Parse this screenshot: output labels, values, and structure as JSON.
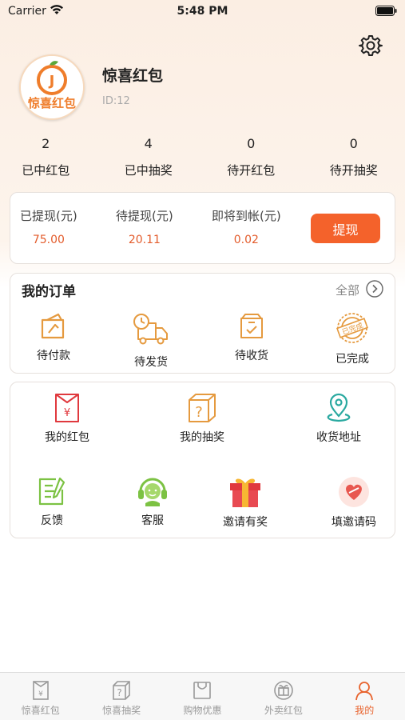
{
  "status_bar": {
    "carrier": "Carrier",
    "time": "5:48 PM"
  },
  "profile": {
    "avatar_logo_text": "J",
    "avatar_caption": "惊喜红包",
    "name": "惊喜红包",
    "id_text": "ID:12"
  },
  "stats": [
    {
      "count": "2",
      "label": "已中红包"
    },
    {
      "count": "4",
      "label": "已中抽奖"
    },
    {
      "count": "0",
      "label": "待开红包"
    },
    {
      "count": "0",
      "label": "待开抽奖"
    }
  ],
  "wallet": {
    "withdrawn_label": "已提现(元)",
    "withdrawn_value": "75.00",
    "pending_label": "待提现(元)",
    "pending_value": "20.11",
    "arriving_label": "即将到帐(元)",
    "arriving_value": "0.02",
    "withdraw_button": "提现"
  },
  "orders": {
    "title": "我的订单",
    "all_label": "全部",
    "items": [
      {
        "label": "待付款",
        "icon": "wallet-icon"
      },
      {
        "label": "待发货",
        "icon": "truck-icon"
      },
      {
        "label": "待收货",
        "icon": "box-icon"
      },
      {
        "label": "已完成",
        "icon": "completed-stamp-icon",
        "stamp_text": "已完成"
      }
    ]
  },
  "menu": {
    "items": [
      {
        "label": "我的红包",
        "icon": "red-envelope-icon",
        "glyph": "¥"
      },
      {
        "label": "我的抽奖",
        "icon": "mystery-box-icon",
        "glyph": "?"
      },
      {
        "label": "收货地址",
        "icon": "location-pin-icon"
      },
      {
        "label": "反馈",
        "icon": "feedback-icon"
      },
      {
        "label": "客服",
        "icon": "customer-service-icon"
      },
      {
        "label": "邀请有奖",
        "icon": "gift-icon"
      },
      {
        "label": "填邀请码",
        "icon": "invite-code-icon"
      }
    ]
  },
  "tabbar": {
    "items": [
      {
        "label": "惊喜红包",
        "icon": "red-envelope-tab-icon",
        "glyph": "¥"
      },
      {
        "label": "惊喜抽奖",
        "icon": "lottery-tab-icon",
        "glyph": "?"
      },
      {
        "label": "购物优惠",
        "icon": "shopping-bag-tab-icon"
      },
      {
        "label": "外卖红包",
        "icon": "takeout-gift-tab-icon"
      },
      {
        "label": "我的",
        "icon": "profile-tab-icon",
        "active": true
      }
    ]
  },
  "colors": {
    "accent": "#f4622b",
    "value_text": "#e35c2c",
    "tab_active": "#e8632d",
    "icon_orange": "#e59a3f",
    "icon_teal": "#2aa9a0",
    "icon_green": "#7cc243",
    "icon_red": "#e0393e"
  }
}
